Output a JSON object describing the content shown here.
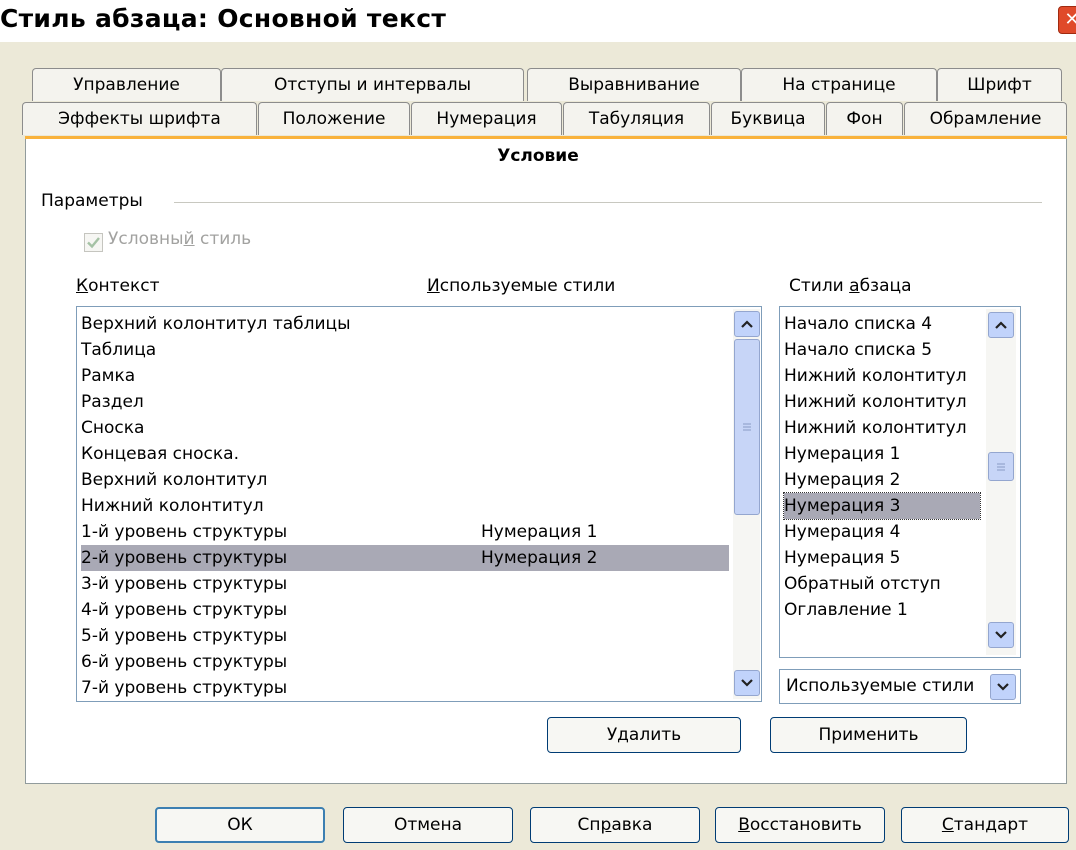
{
  "window": {
    "title": "Стиль абзаца: Основной текст",
    "close_glyph": "✕"
  },
  "tabs_row1": [
    "Управление",
    "Отступы и интервалы",
    "Выравнивание",
    "На странице",
    "Шрифт"
  ],
  "tabs_row2": [
    "Эффекты шрифта",
    "Положение",
    "Нумерация",
    "Табуляция",
    "Буквица",
    "Фон",
    "Обрамление"
  ],
  "active_tab": "Условие",
  "params": {
    "group_label": "Параметры",
    "checkbox_label_pre": "Условны",
    "checkbox_label_ul": "й",
    "checkbox_label_post": " стиль",
    "checked": true,
    "enabled": false
  },
  "columns": {
    "context_ul": "К",
    "context_rest": "онтекст",
    "used_ul": "И",
    "used_rest": "спользуемые стили",
    "para_pre": "Стили ",
    "para_ul": "а",
    "para_post": "бзаца"
  },
  "context_list": [
    {
      "context": "Верхний колонтитул таблицы",
      "style": ""
    },
    {
      "context": "Таблица",
      "style": ""
    },
    {
      "context": "Рамка",
      "style": ""
    },
    {
      "context": "Раздел",
      "style": ""
    },
    {
      "context": "Сноска",
      "style": ""
    },
    {
      "context": "Концевая сноска.",
      "style": ""
    },
    {
      "context": "Верхний колонтитул",
      "style": ""
    },
    {
      "context": "Нижний колонтитул",
      "style": ""
    },
    {
      "context": "1-й уровень структуры",
      "style": "Нумерация 1"
    },
    {
      "context": "2-й уровень структуры",
      "style": "Нумерация 2",
      "selected": true
    },
    {
      "context": "3-й уровень структуры",
      "style": ""
    },
    {
      "context": "4-й уровень структуры",
      "style": ""
    },
    {
      "context": "5-й уровень структуры",
      "style": ""
    },
    {
      "context": "6-й уровень структуры",
      "style": ""
    },
    {
      "context": "7-й уровень структуры",
      "style": ""
    }
  ],
  "para_styles": [
    "Начало списка 4",
    "Начало списка 5",
    "Нижний колонтитул",
    "Нижний колонтитул",
    "Нижний колонтитул",
    "Нумерация 1",
    "Нумерация 2",
    "Нумерация 3",
    "Нумерация 4",
    "Нумерация 5",
    "Обратный отступ",
    "Оглавление 1"
  ],
  "para_styles_selected_index": 7,
  "filter_combo": {
    "value": "Используемые стили"
  },
  "actions": {
    "remove": "Удалить",
    "apply": "Применить"
  },
  "footer": {
    "ok": "ОК",
    "cancel": "Отмена",
    "help_pre": "Сп",
    "help_ul": "р",
    "help_post": "авка",
    "reset_ul": "В",
    "reset_rest": "осстановить",
    "standard_ul": "С",
    "standard_rest": "тандарт"
  },
  "colors": {
    "accent_tab": "#F9B23C",
    "dialog_bg": "#ECE9D8",
    "selection": "#A9A9B5",
    "scroll_button": "#C1D3FB"
  }
}
